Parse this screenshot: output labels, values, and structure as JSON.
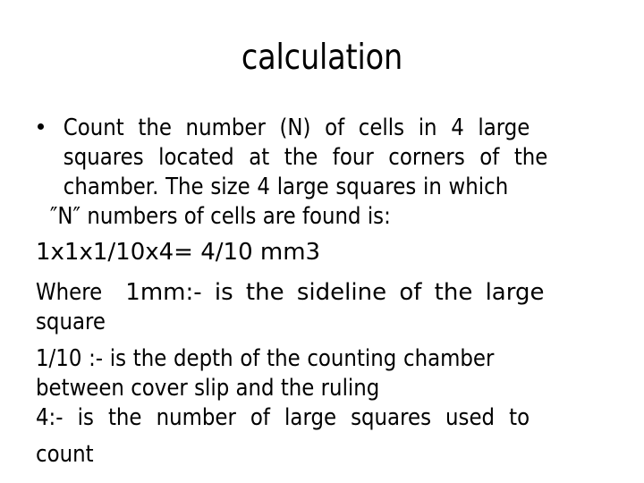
{
  "slide": {
    "title": "calculation",
    "background_color": "#ffffff",
    "text_color": "#000000",
    "bullet_glyph": "•",
    "body_lines": [
      {
        "id": "line1",
        "text": "Count  the  number  (N)  of  cells  in  4  large",
        "bulleted": true,
        "justified": true
      },
      {
        "id": "line2",
        "text": "squares  located  at  the  four  corners  of  the",
        "bulleted": false,
        "justified": true
      },
      {
        "id": "line3",
        "text": "chamber. The size 4 large squares in which",
        "bulleted": false,
        "justified": false
      },
      {
        "id": "line4",
        "text": "″N″   numbers of cells are found is:",
        "bulleted": false,
        "justified": false
      },
      {
        "id": "line5",
        "text": "1x1x1/10x4= 4/10 mm3",
        "bulleted": false,
        "justified": false
      },
      {
        "id": "line6_a",
        "text": "Where",
        "bulleted": false,
        "justified": true
      },
      {
        "id": "line6_b",
        "text": "1mm:-  is  the  sideline  of  the  large",
        "bulleted": false,
        "justified": true
      },
      {
        "id": "line7",
        "text": "square",
        "bulleted": false,
        "justified": false
      },
      {
        "id": "line8",
        "text": "1/10 :- is the depth of the counting chamber",
        "bulleted": false,
        "justified": true
      },
      {
        "id": "line9",
        "text": "between cover slip and the ruling",
        "bulleted": false,
        "justified": false
      },
      {
        "id": "line10",
        "text": "4:-  is  the  number  of  large  squares  used  to",
        "bulleted": false,
        "justified": true
      },
      {
        "id": "line11",
        "text": "count",
        "bulleted": false,
        "justified": false
      }
    ]
  }
}
